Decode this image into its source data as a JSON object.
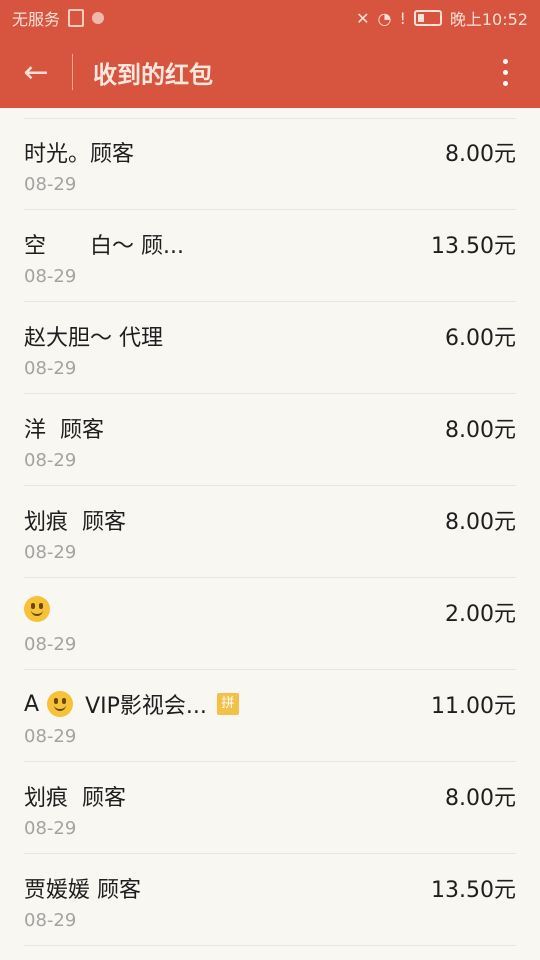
{
  "status_bar": {
    "carrier": "无服务",
    "time": "晚上10:52"
  },
  "app_bar": {
    "title": "收到的红包"
  },
  "rows": [
    {
      "name": "时光。顾客",
      "amount": "8.00元",
      "date": "08-29"
    },
    {
      "name": "空　　白～ 顾...",
      "amount": "13.50元",
      "date": "08-29"
    },
    {
      "name": "赵大胆～ 代理",
      "amount": "6.00元",
      "date": "08-29"
    },
    {
      "name": "洋  顾客",
      "amount": "8.00元",
      "date": "08-29"
    },
    {
      "name": "划痕  顾客",
      "amount": "8.00元",
      "date": "08-29"
    },
    {
      "name": "",
      "amount": "2.00元",
      "date": "08-29"
    },
    {
      "name_prefix": "A",
      "name_suffix": "VIP影视会...",
      "badge": "拼",
      "amount": "11.00元",
      "date": "08-29"
    },
    {
      "name": "划痕  顾客",
      "amount": "8.00元",
      "date": "08-29"
    },
    {
      "name": "贾媛媛 顾客",
      "amount": "13.50元",
      "date": "08-29"
    }
  ]
}
